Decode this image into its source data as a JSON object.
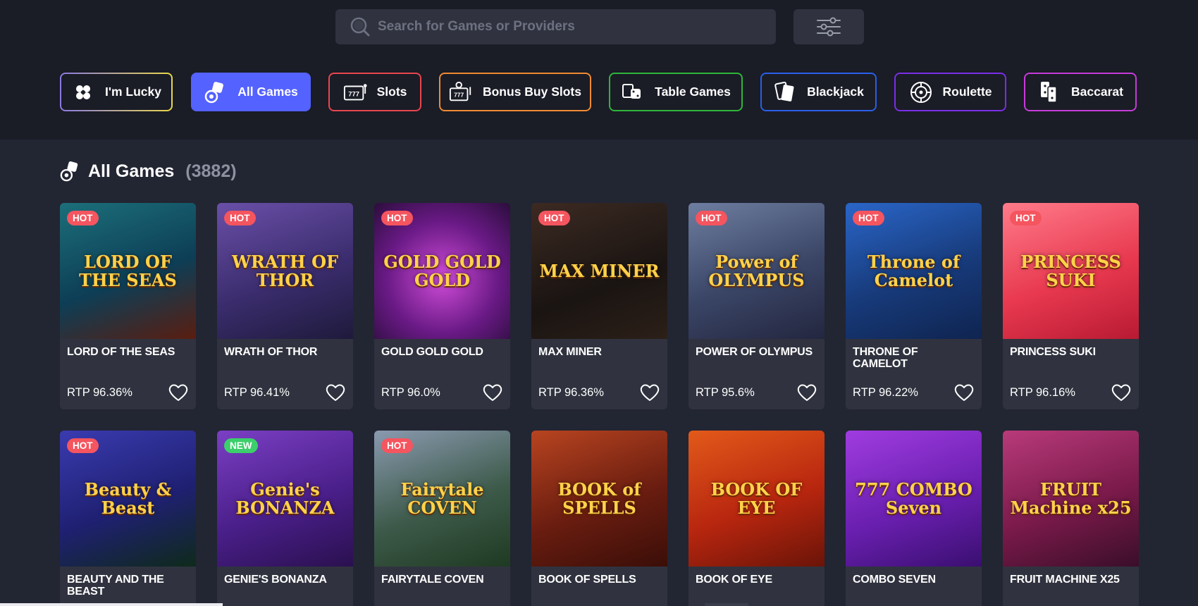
{
  "search": {
    "placeholder": "Search for Games or Providers",
    "value": ""
  },
  "categories": [
    {
      "label": "I'm Lucky",
      "icon": "clover-icon",
      "color": "gradient"
    },
    {
      "label": "All Games",
      "icon": "dice-icon",
      "color": "#5462ff",
      "active": true
    },
    {
      "label": "Slots",
      "icon": "slot-machine-icon",
      "color": "#e8464e"
    },
    {
      "label": "Bonus Buy Slots",
      "icon": "bonus-slot-icon",
      "color": "#f08b32"
    },
    {
      "label": "Table Games",
      "icon": "table-games-icon",
      "color": "#2fb63a"
    },
    {
      "label": "Blackjack",
      "icon": "cards-icon",
      "color": "#2b5fe8"
    },
    {
      "label": "Roulette",
      "icon": "roulette-icon",
      "color": "#7a2ee6"
    },
    {
      "label": "Baccarat",
      "icon": "dominoes-icon",
      "color": "#c63cd8"
    }
  ],
  "section": {
    "title": "All Games",
    "count": "(3882)"
  },
  "games": [
    {
      "name": "LORD OF THE SEAS",
      "rtp": "RTP 96.36%",
      "badge": "HOT",
      "art": "LORD OF THE SEAS",
      "bg": "linear-gradient(160deg,#1c6f7a,#0d3e56 55%,#5a1d10)"
    },
    {
      "name": "WRATH OF THOR",
      "rtp": "RTP 96.41%",
      "badge": "HOT",
      "art": "WRATH OF THOR",
      "bg": "linear-gradient(160deg,#6a4fa8,#3b2d6e 55%,#1e1a3b)"
    },
    {
      "name": "GOLD GOLD GOLD",
      "rtp": "RTP 96.0%",
      "badge": "HOT",
      "art": "GOLD GOLD GOLD",
      "bg": "radial-gradient(circle at 50% 55%,#d04cd8,#6a1a86 55%,#2b0d3c)"
    },
    {
      "name": "MAX MINER",
      "rtp": "RTP 96.36%",
      "badge": "HOT",
      "art": "MAX MINER",
      "bg": "linear-gradient(160deg,#3c2a22,#1a1412 60%,#2c2018)"
    },
    {
      "name": "POWER OF OLYMPUS",
      "rtp": "RTP 95.6%",
      "badge": "HOT",
      "art": "Power of OLYMPUS",
      "bg": "linear-gradient(160deg,#6e7ea0,#3a4566 55%,#23263f)"
    },
    {
      "name": "THRONE OF CAMELOT",
      "rtp": "RTP 96.22%",
      "badge": "HOT",
      "art": "Throne of Camelot",
      "bg": "linear-gradient(160deg,#2a66c8,#173a7a 55%,#0f2450)"
    },
    {
      "name": "PRINCESS SUKI",
      "rtp": "RTP 96.16%",
      "badge": "HOT",
      "art": "PRINCESS SUKI",
      "bg": "linear-gradient(160deg,#ff7b8a,#e8394f 55%,#b81a33)"
    },
    {
      "name": "BEAUTY AND THE BEAST",
      "rtp": "",
      "badge": "HOT",
      "art": "Beauty & Beast",
      "bg": "linear-gradient(160deg,#3a3bb0,#1f2072 55%,#0e2a1a)"
    },
    {
      "name": "GENIE'S BONANZA",
      "rtp": "",
      "badge": "NEW",
      "art": "Genie's BONANZA",
      "bg": "linear-gradient(160deg,#7b3fc4,#4a1f8a 55%,#2a104f)"
    },
    {
      "name": "FAIRYTALE COVEN",
      "rtp": "",
      "badge": "HOT",
      "art": "Fairytale COVEN",
      "bg": "linear-gradient(160deg,#8a9ab0,#3d5a4a 55%,#1f3a22)"
    },
    {
      "name": "BOOK OF SPELLS",
      "rtp": "",
      "badge": "",
      "art": "BOOK of SPELLS",
      "bg": "linear-gradient(160deg,#b84420,#6a1d10 55%,#3a0e08)"
    },
    {
      "name": "BOOK OF EYE",
      "rtp": "",
      "badge": "",
      "art": "BOOK OF EYE",
      "bg": "linear-gradient(160deg,#e25a1a,#b8260f 55%,#6a1408)"
    },
    {
      "name": "COMBO SEVEN",
      "rtp": "",
      "badge": "",
      "art": "777 COMBO Seven",
      "bg": "linear-gradient(160deg,#a03ce0,#6a1fb0 55%,#3a0f70)"
    },
    {
      "name": "FRUIT MACHINE X25",
      "rtp": "",
      "badge": "",
      "art": "FRUIT Machine x25",
      "bg": "linear-gradient(160deg,#b83a7a,#7a1a4a 55%,#3a0e2a)"
    }
  ]
}
